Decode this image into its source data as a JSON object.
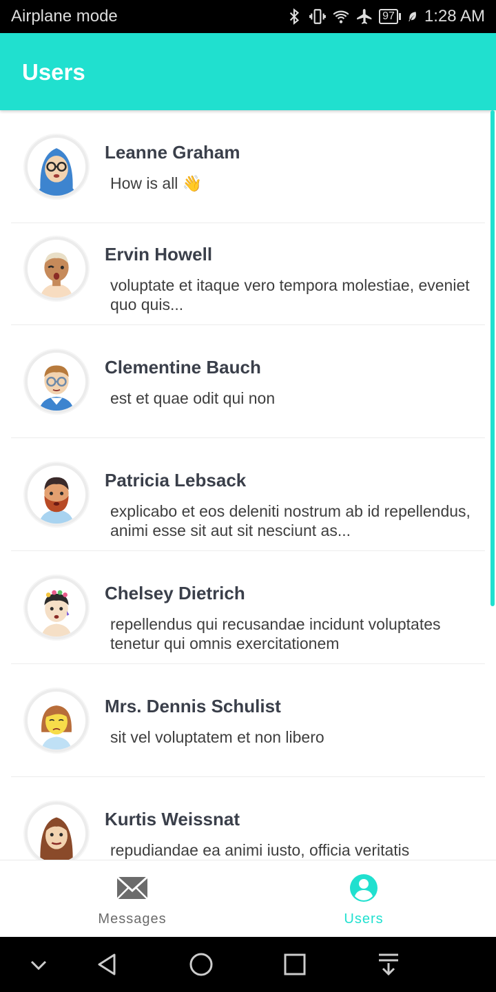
{
  "status_bar": {
    "left_text": "Airplane mode",
    "battery": "97",
    "time": "1:28 AM",
    "icons": [
      "bluetooth-icon",
      "vibrate-icon",
      "wifi-icon",
      "airplane-icon",
      "battery-icon",
      "leaf-icon"
    ]
  },
  "app_bar": {
    "title": "Users"
  },
  "users": [
    {
      "name": "Leanne Graham",
      "message": "How is all 👋",
      "avatar": "woman-hijab-glasses-avatar"
    },
    {
      "name": "Ervin Howell",
      "message": "voluptate et itaque vero tempora molestiae, eveniet quo quis...",
      "avatar": "man-blond-avatar"
    },
    {
      "name": "Clementine Bauch",
      "message": "est et quae odit qui non",
      "avatar": "man-glasses-avatar"
    },
    {
      "name": "Patricia Lebsack",
      "message": "explicabo et eos deleniti nostrum ab id repellendus, animi esse sit aut sit nesciunt as...",
      "avatar": "man-beard-avatar"
    },
    {
      "name": "Chelsey Dietrich",
      "message": "repellendus qui recusandae incidunt voluptates tenetur qui omnis exercitationem",
      "avatar": "woman-flower-crown-avatar"
    },
    {
      "name": "Mrs. Dennis Schulist",
      "message": "sit vel voluptatem et non libero",
      "avatar": "woman-yellow-face-avatar"
    },
    {
      "name": "Kurtis Weissnat",
      "message": "repudiandae ea animi iusto, officia veritatis",
      "avatar": "woman-long-hair-avatar"
    }
  ],
  "bottom_nav": {
    "messages_label": "Messages",
    "users_label": "Users",
    "active": "Users",
    "accent_color": "#20E0CF",
    "inactive_color": "#6b6b6b"
  },
  "system_nav": {
    "icons": [
      "chevron-down-icon",
      "back-icon",
      "home-icon",
      "recents-icon",
      "notification-pull-icon"
    ]
  }
}
